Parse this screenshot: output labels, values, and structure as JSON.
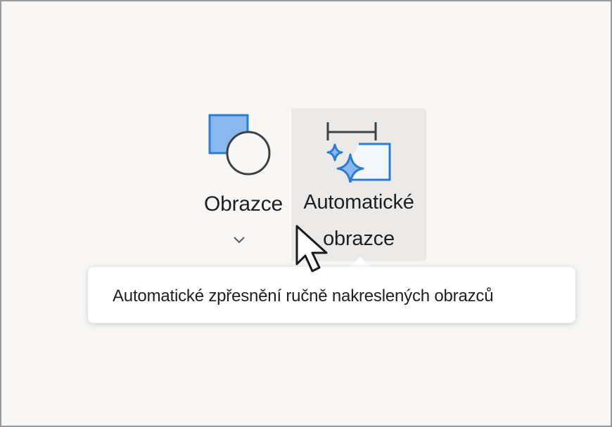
{
  "ribbon": {
    "shapes_button": {
      "label": "Obrazce",
      "icon": "shapes-icon",
      "dropdown_icon": "chevron-down-icon"
    },
    "auto_shapes_button": {
      "label_line1": "Automatické",
      "label_line2": "obrazce",
      "icon": "auto-shapes-icon",
      "state": "hover"
    }
  },
  "tooltip": {
    "text": "Automatické zpřesnění ručně nakreslených obrazců"
  },
  "cursor": {
    "icon": "mouse-pointer-icon"
  },
  "colors": {
    "background": "#f8f7f5",
    "hover_background": "#ebeae8",
    "icon_blue": "#2b7cd3",
    "icon_blue_fill": "#8ab8ee",
    "icon_dark": "#404040",
    "text": "#1f1f1f"
  }
}
